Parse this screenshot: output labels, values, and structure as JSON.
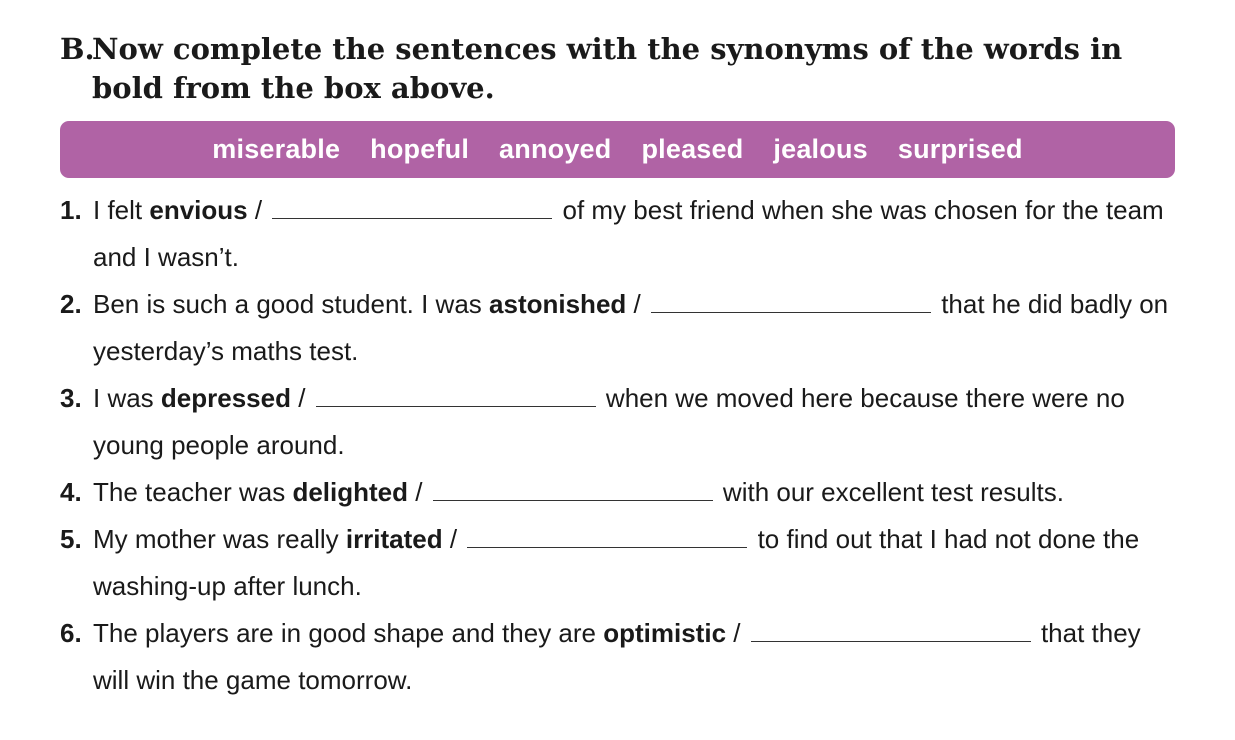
{
  "exercise": {
    "letter": "B.",
    "instruction": "Now complete the sentences with the synonyms of the words in bold from the box above."
  },
  "word_box": [
    "miserable",
    "hopeful",
    "annoyed",
    "pleased",
    "jealous",
    "surprised"
  ],
  "items": [
    {
      "num": "1.",
      "before": "I felt ",
      "bold": "envious",
      "slash": " /",
      "after": " of my best friend when she was chosen for the team and I wasn’t."
    },
    {
      "num": "2.",
      "before": "Ben is such a good student. I was ",
      "bold": "astonished",
      "slash": " /",
      "after": " that he did badly on yesterday’s maths test."
    },
    {
      "num": "3.",
      "before": "I was ",
      "bold": "depressed",
      "slash": " /",
      "after": " when we moved here because there were no young people around."
    },
    {
      "num": "4.",
      "before": "The teacher was ",
      "bold": "delighted",
      "slash": " /",
      "after": " with our excellent test results."
    },
    {
      "num": "5.",
      "before": "My mother was really ",
      "bold": "irritated",
      "slash": " /",
      "after": " to find out that I had not done the washing-up after lunch."
    },
    {
      "num": "6.",
      "before": "The players are in good shape and they are ",
      "bold": "optimistic",
      "slash": " /",
      "after": " that they will win the game tomorrow."
    }
  ],
  "colors": {
    "box_bg": "#b063a5",
    "box_text": "#ffffff",
    "text": "#1a1a1a"
  }
}
